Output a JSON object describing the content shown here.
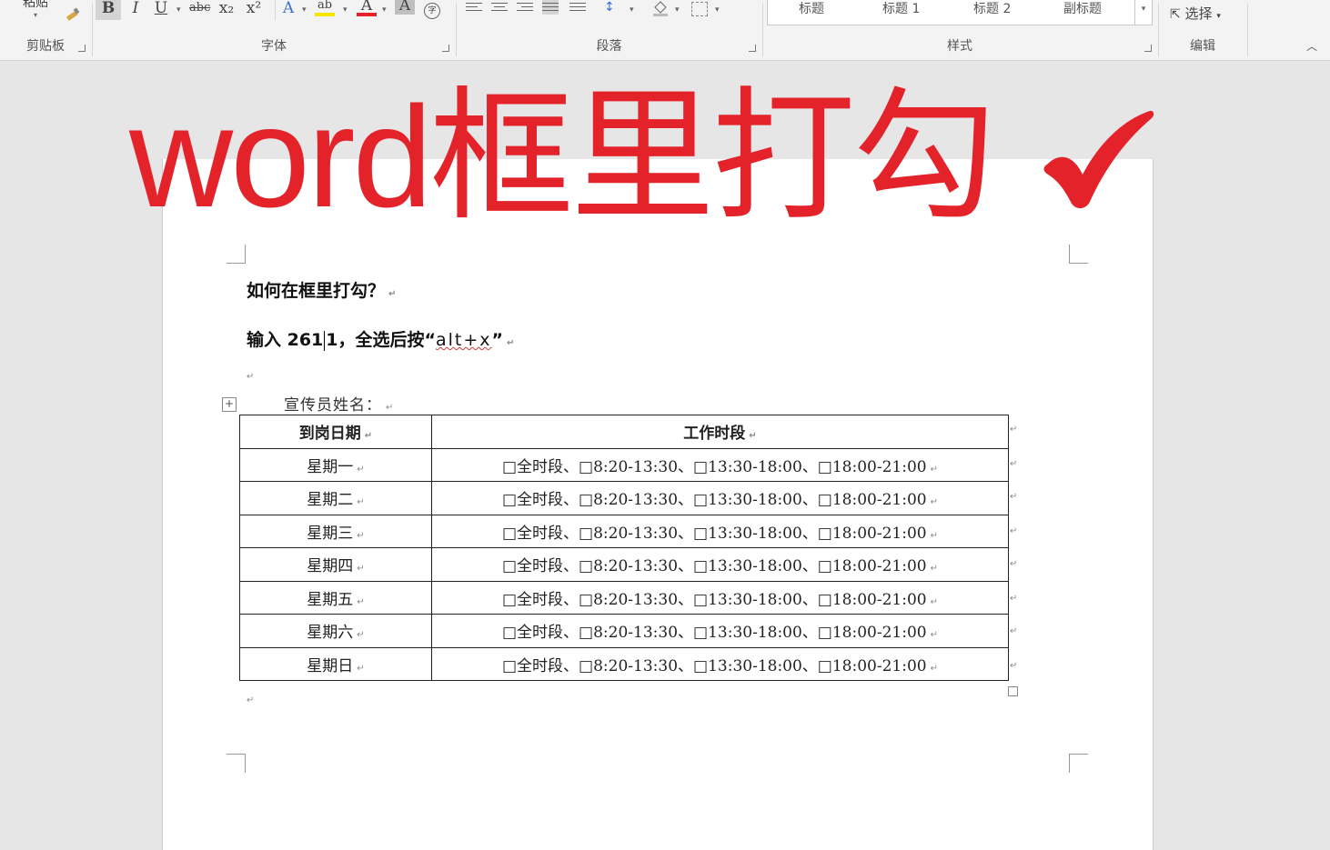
{
  "ribbon": {
    "clipboard": {
      "paste_label": "粘贴",
      "group_label": "剪贴板"
    },
    "font": {
      "group_label": "字体",
      "buttons": {
        "bold": "B",
        "italic": "I",
        "underline": "U",
        "strike": "abc",
        "sub": "x₂",
        "sup": "x²",
        "text_effect": "A",
        "highlight": "ab",
        "font_color": "A",
        "char_shading": "A",
        "enclose": "字"
      }
    },
    "paragraph": {
      "group_label": "段落"
    },
    "styles": {
      "group_label": "样式",
      "items": [
        "标题",
        "标题 1",
        "标题 2",
        "副标题"
      ]
    },
    "editing": {
      "group_label": "编辑",
      "select_label": "选择"
    }
  },
  "colors": {
    "overlay": "#e4222a",
    "ribbon": "#f3f3f3",
    "page": "#ffffff"
  },
  "overlay": {
    "title": "word框里打勾"
  },
  "document": {
    "question": "如何在框里打勾？",
    "instruction_before_cursor": "输入 261",
    "instruction_after_cursor": "1，全选后按“",
    "instruction_key": "alt+x",
    "instruction_end": "”",
    "form_label": "宣传员姓名：",
    "table": {
      "headers": [
        "到岗日期",
        "工作时段"
      ],
      "rows": [
        {
          "day": "星期一",
          "slots": "□全时段、□8:20-13:30、□13:30-18:00、□18:00-21:00"
        },
        {
          "day": "星期二",
          "slots": "□全时段、□8:20-13:30、□13:30-18:00、□18:00-21:00"
        },
        {
          "day": "星期三",
          "slots": "□全时段、□8:20-13:30、□13:30-18:00、□18:00-21:00"
        },
        {
          "day": "星期四",
          "slots": "□全时段、□8:20-13:30、□13:30-18:00、□18:00-21:00"
        },
        {
          "day": "星期五",
          "slots": "□全时段、□8:20-13:30、□13:30-18:00、□18:00-21:00"
        },
        {
          "day": "星期六",
          "slots": "□全时段、□8:20-13:30、□13:30-18:00、□18:00-21:00"
        },
        {
          "day": "星期日",
          "slots": "□全时段、□8:20-13:30、□13:30-18:00、□18:00-21:00"
        }
      ]
    }
  },
  "marks": {
    "paragraph": "↵",
    "table_move": "+"
  }
}
